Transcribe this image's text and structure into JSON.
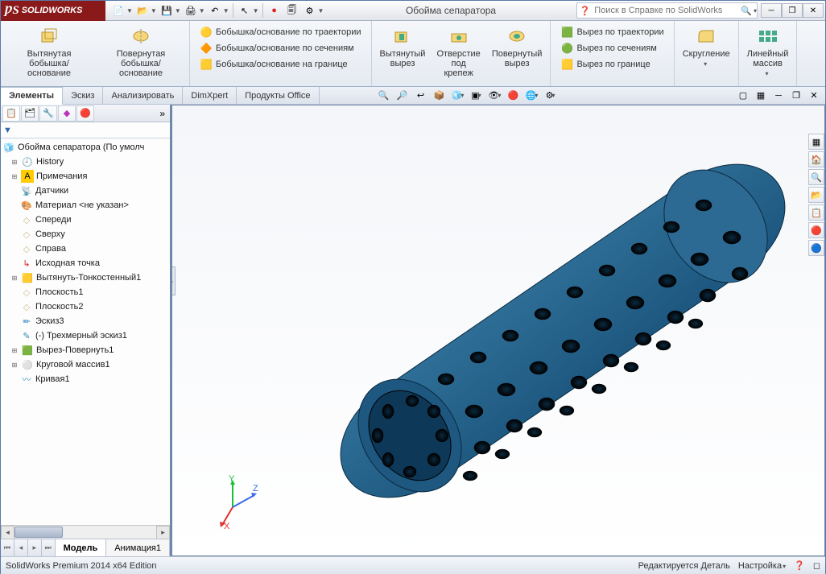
{
  "logo_text": "SOLIDWORKS",
  "document_title": "Обойма сепаратора",
  "search": {
    "placeholder": "Поиск в Справке по SolidWorks"
  },
  "ribbon": {
    "extruded_boss": "Вытянутая\nбобышка/основание",
    "revolved_boss": "Повернутая\nбобышка/основание",
    "swept_boss": "Бобышка/основание по траектории",
    "lofted_boss": "Бобышка/основание по сечениям",
    "boundary_boss": "Бобышка/основание на границе",
    "extruded_cut": "Вытянутый\nвырез",
    "hole_wizard": "Отверстие\nпод\nкрепеж",
    "revolved_cut": "Повернутый\nвырез",
    "swept_cut": "Вырез по траектории",
    "lofted_cut": "Вырез по сечениям",
    "boundary_cut": "Вырез по границе",
    "fillet": "Скругление",
    "linear_pattern": "Линейный\nмассив"
  },
  "tabs": {
    "features": "Элементы",
    "sketch": "Эскиз",
    "evaluate": "Анализировать",
    "dimxpert": "DimXpert",
    "office": "Продукты Office"
  },
  "tree": {
    "root": "Обойма сепаратора  (По умолч",
    "history": "History",
    "annotations": "Примечания",
    "sensors": "Датчики",
    "material": "Материал <не указан>",
    "front": "Спереди",
    "top": "Сверху",
    "right": "Справа",
    "origin": "Исходная точка",
    "extrude_thin": "Вытянуть-Тонкостенный1",
    "plane1": "Плоскость1",
    "plane2": "Плоскость2",
    "sketch3": "Эскиз3",
    "sketch3d": "(-) Трехмерный эскиз1",
    "cut_revolve": "Вырез-Повернуть1",
    "circ_pattern": "Круговой массив1",
    "curve1": "Кривая1"
  },
  "bottom_tabs": {
    "model": "Модель",
    "animation": "Анимация1"
  },
  "status": {
    "edition": "SolidWorks Premium 2014 x64 Edition",
    "editing": "Редактируется Деталь",
    "settings": "Настройка"
  }
}
